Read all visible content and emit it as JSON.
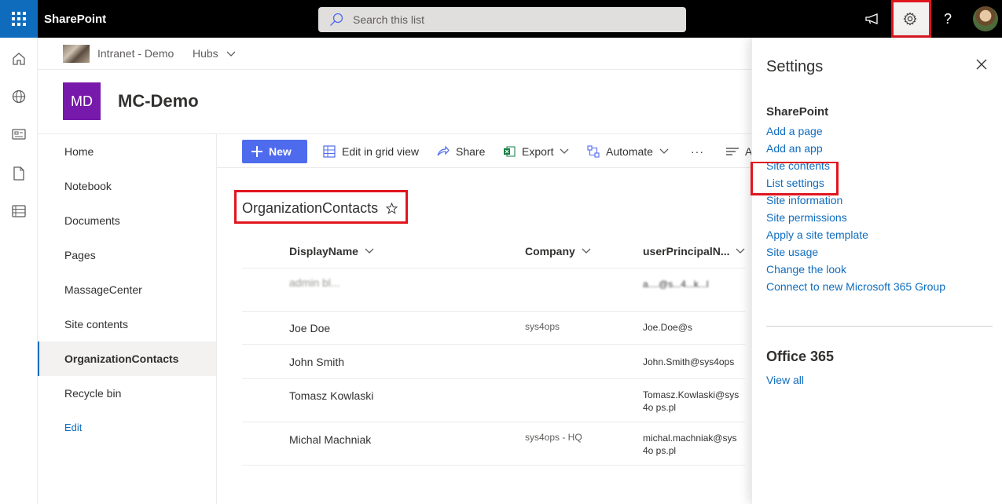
{
  "topbar": {
    "brand": "SharePoint",
    "search_placeholder": "Search this list",
    "icons": [
      "waffle-icon",
      "search-icon",
      "megaphone-icon",
      "gear-icon",
      "help-icon",
      "avatar"
    ],
    "help_label": "?"
  },
  "rail": {
    "icons": [
      "home-icon",
      "globe-icon",
      "news-icon",
      "document-icon",
      "list-icon"
    ]
  },
  "hubbar": {
    "site_name": "Intranet - Demo",
    "hubs_label": "Hubs"
  },
  "site": {
    "logo_initials": "MD",
    "title": "MC-Demo",
    "logo_color": "#7719aa"
  },
  "nav": {
    "items": [
      {
        "label": "Home"
      },
      {
        "label": "Notebook"
      },
      {
        "label": "Documents"
      },
      {
        "label": "Pages"
      },
      {
        "label": "MassageCenter"
      },
      {
        "label": "Site contents"
      },
      {
        "label": "OrganizationContacts",
        "active": true
      },
      {
        "label": "Recycle bin"
      }
    ],
    "edit_label": "Edit"
  },
  "commandbar": {
    "new_label": "New",
    "edit_grid_label": "Edit in grid view",
    "share_label": "Share",
    "export_label": "Export",
    "automate_label": "Automate",
    "more_label": "···",
    "truncated_label": "A"
  },
  "list": {
    "title": "OrganizationContacts",
    "columns": [
      "DisplayName",
      "Company",
      "userPrincipalN..."
    ],
    "rows": [
      {
        "name": "admin bl...",
        "company": "",
        "upn": "a....@s...4...k...l"
      },
      {
        "name": "Joe Doe",
        "company": "sys4ops",
        "upn": "Joe.Doe@s"
      },
      {
        "name": "John Smith",
        "company": "",
        "upn": "John.Smith@sys4ops"
      },
      {
        "name": "Tomasz Kowlaski",
        "company": "",
        "upn": "Tomasz.Kowlaski@sys4o ps.pl"
      },
      {
        "name": "Michal Machniak",
        "company": "sys4ops - HQ",
        "upn": "michal.machniak@sys4o ps.pl"
      }
    ]
  },
  "settings": {
    "title": "Settings",
    "sharepoint_heading": "SharePoint",
    "links": [
      "Add a page",
      "Add an app",
      "Site contents",
      "List settings",
      "Site information",
      "Site permissions",
      "Apply a site template",
      "Site usage",
      "Change the look",
      "Connect to new Microsoft 365 Group"
    ],
    "office_heading": "Office 365",
    "view_all": "View all"
  },
  "colors": {
    "accent": "#0f6cbd",
    "new_button": "#4f6bed",
    "highlight": "#e0161f"
  }
}
